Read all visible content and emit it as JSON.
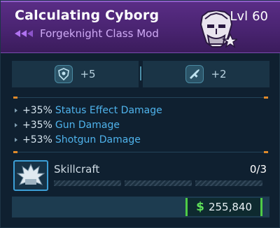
{
  "item": {
    "name": "Calculating Cyborg",
    "type": "Forgeknight Class Mod",
    "level_label": "Lvl",
    "level": "60",
    "rarity_color": "#b072f0"
  },
  "stats": [
    {
      "icon": "shield-badge-icon",
      "value": "+5"
    },
    {
      "icon": "weapon-badge-icon",
      "value": "+2"
    }
  ],
  "effects": [
    {
      "amount": "+35%",
      "name": "Status Effect Damage"
    },
    {
      "amount": "+35%",
      "name": "Gun Damage"
    },
    {
      "amount": "+53%",
      "name": "Shotgun Damage"
    }
  ],
  "skill": {
    "name": "Skillcraft",
    "count": "0/3",
    "icon": "spiked-crown-icon"
  },
  "price": {
    "currency_symbol": "$",
    "value": "255,840",
    "color": "#5fe05a"
  }
}
